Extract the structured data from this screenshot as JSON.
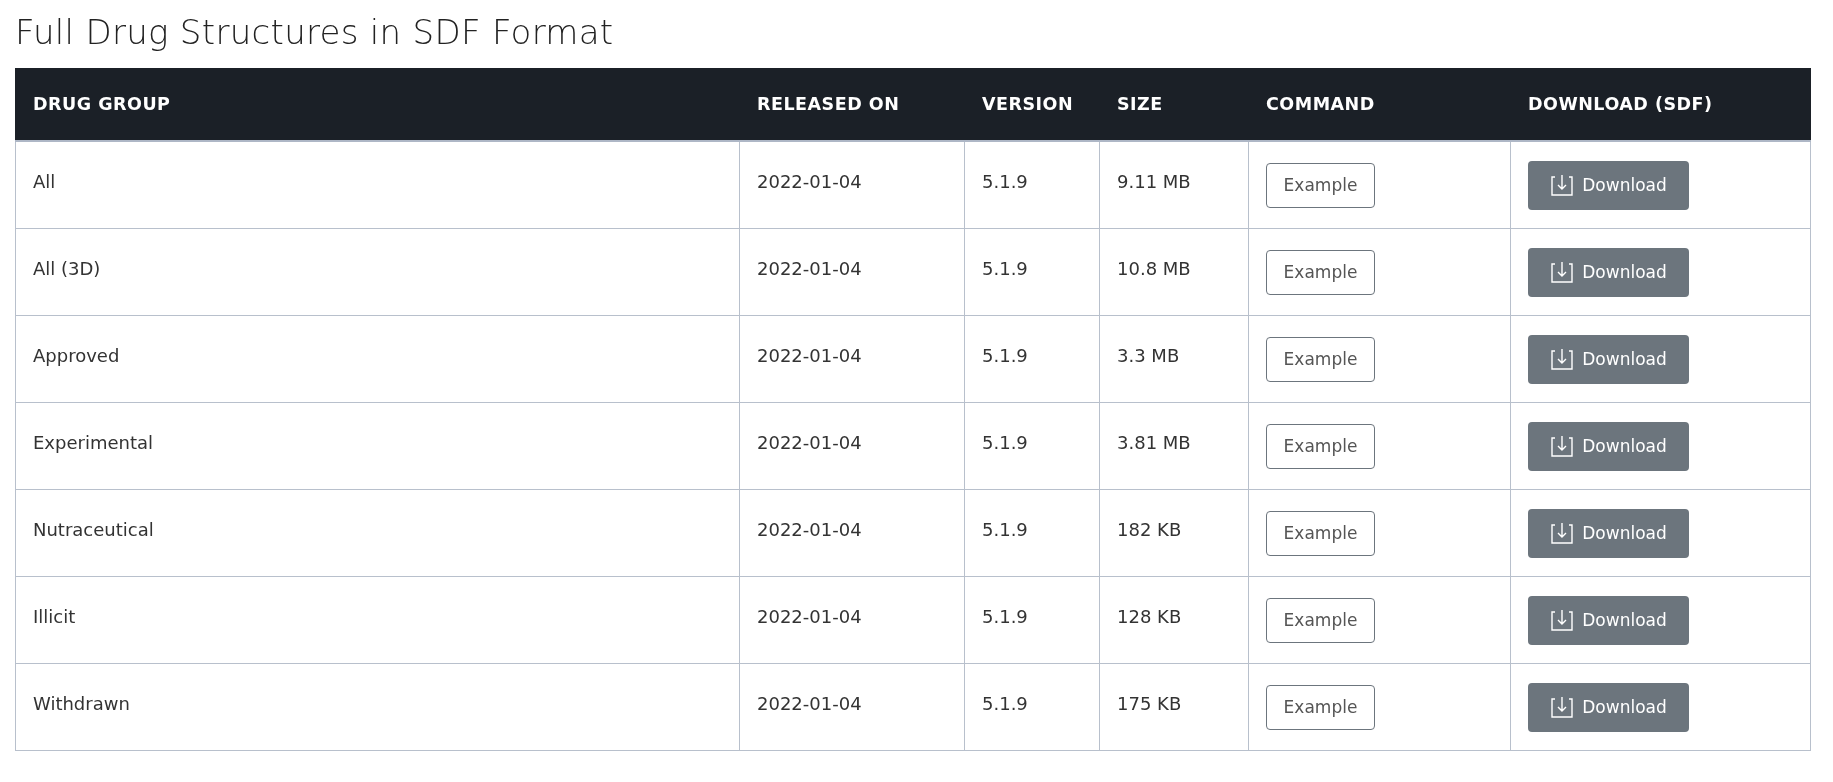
{
  "title": "Full Drug Structures in SDF Format",
  "table": {
    "columns": [
      "DRUG GROUP",
      "RELEASED ON",
      "VERSION",
      "SIZE",
      "COMMAND",
      "DOWNLOAD (SDF)"
    ],
    "rows": [
      {
        "group": "All",
        "released": "2022-01-04",
        "version": "5.1.9",
        "size": "9.11 MB",
        "command": "Example",
        "download": "Download"
      },
      {
        "group": "All (3D)",
        "released": "2022-01-04",
        "version": "5.1.9",
        "size": "10.8 MB",
        "command": "Example",
        "download": "Download"
      },
      {
        "group": "Approved",
        "released": "2022-01-04",
        "version": "5.1.9",
        "size": "3.3 MB",
        "command": "Example",
        "download": "Download"
      },
      {
        "group": "Experimental",
        "released": "2022-01-04",
        "version": "5.1.9",
        "size": "3.81 MB",
        "command": "Example",
        "download": "Download"
      },
      {
        "group": "Nutraceutical",
        "released": "2022-01-04",
        "version": "5.1.9",
        "size": "182 KB",
        "command": "Example",
        "download": "Download"
      },
      {
        "group": "Illicit",
        "released": "2022-01-04",
        "version": "5.1.9",
        "size": "128 KB",
        "command": "Example",
        "download": "Download"
      },
      {
        "group": "Withdrawn",
        "released": "2022-01-04",
        "version": "5.1.9",
        "size": "175 KB",
        "command": "Example",
        "download": "Download"
      }
    ]
  }
}
